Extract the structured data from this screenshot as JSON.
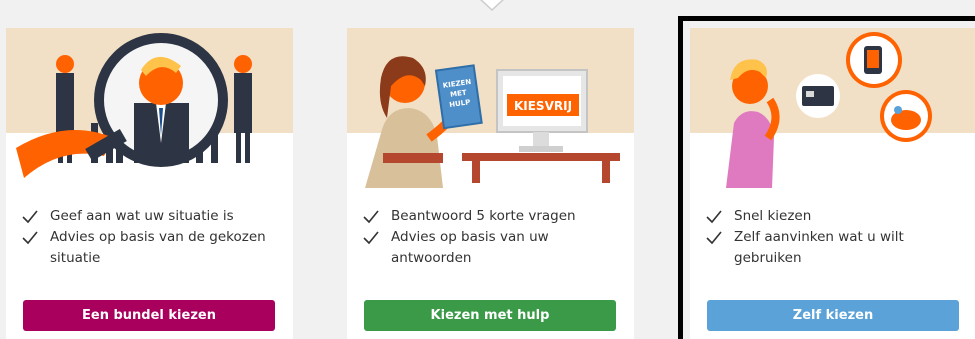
{
  "cards": [
    {
      "bullets": [
        "Geef aan wat uw situatie is",
        "Advies op basis van de gekozen situatie"
      ],
      "button_label": "Een bundel kiezen",
      "button_color": "#a8005c",
      "illustration": "magnifier-people-illustration"
    },
    {
      "bullets": [
        "Beantwoord 5 korte vragen",
        "Advies op basis van uw antwoorden"
      ],
      "button_label": "Kiezen met hulp",
      "button_color": "#3a9a48",
      "illustration": "woman-with-book-illustration",
      "book_title_lines": [
        "KIEZEN",
        "MET",
        "HULP"
      ],
      "screen_label": "KIESVRIJ"
    },
    {
      "bullets": [
        "Snel kiezen",
        "Zelf aanvinken wat u wilt gebruiken"
      ],
      "button_label": "Zelf kiezen",
      "button_color": "#5aa2d8",
      "illustration": "man-thinking-illustration",
      "selected": true
    }
  ],
  "colors": {
    "banner": "#f1e0c5",
    "ing_orange": "#ff6200",
    "text": "#333333"
  }
}
